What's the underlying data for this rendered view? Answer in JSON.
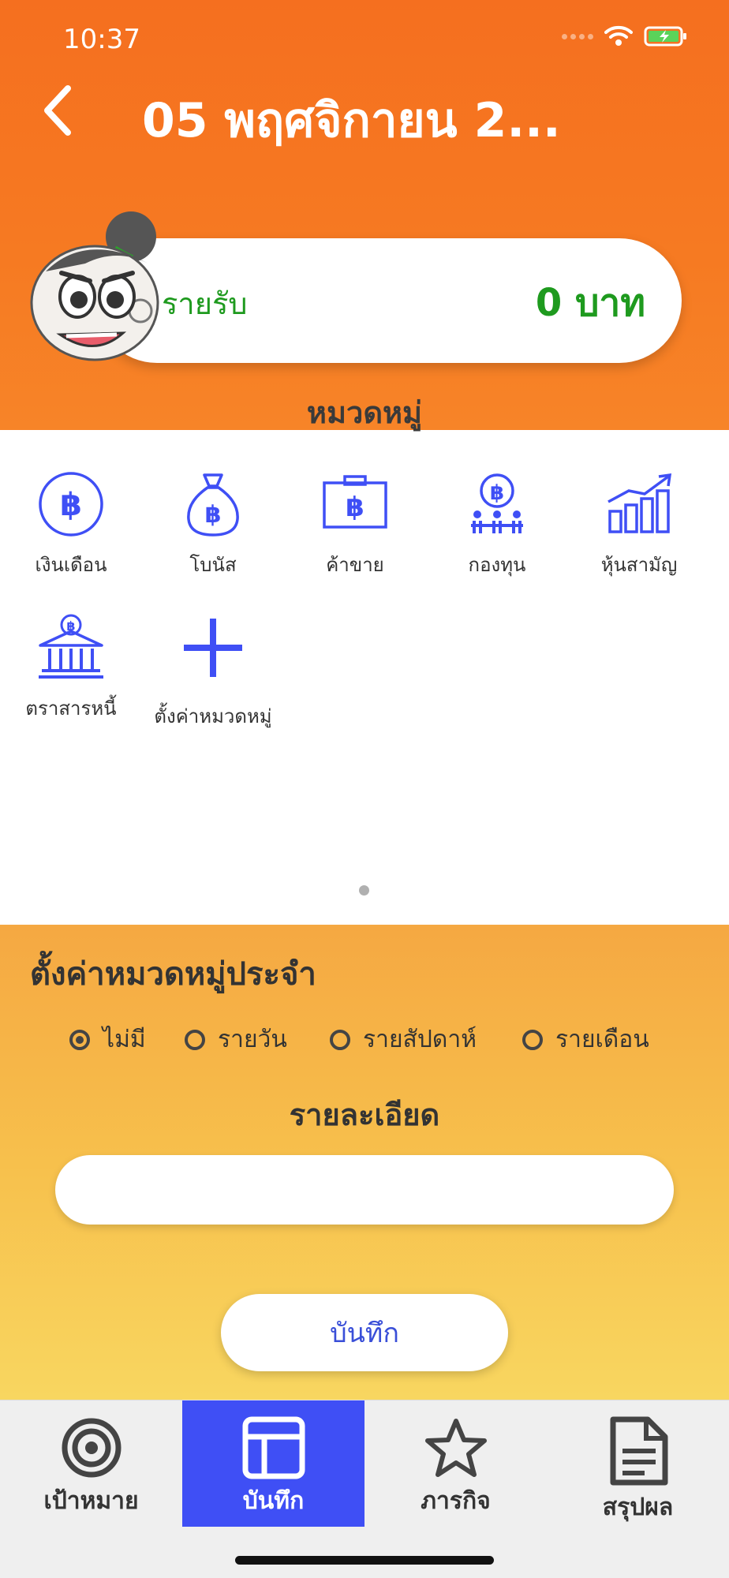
{
  "status_bar": {
    "time": "10:37"
  },
  "header": {
    "title": "05 พฤศจิกายน 2...",
    "back_icon": "chevron-left-icon"
  },
  "income": {
    "label": "รายรับ",
    "value": "0 บาท",
    "color": "#1e9a1e"
  },
  "categories": {
    "heading": "หมวดหมู่",
    "items": [
      {
        "label": "เงินเดือน",
        "icon": "baht-coin-icon"
      },
      {
        "label": "โบนัส",
        "icon": "money-bag-icon"
      },
      {
        "label": "ค้าขาย",
        "icon": "baht-briefcase-icon"
      },
      {
        "label": "กองทุน",
        "icon": "fund-group-icon"
      },
      {
        "label": "หุ้นสามัญ",
        "icon": "stock-chart-icon"
      },
      {
        "label": "ตราสารหนี้",
        "icon": "bank-icon"
      },
      {
        "label": "ตั้งค่าหมวดหมู่",
        "icon": "plus-icon"
      }
    ],
    "accent": "#3f4ff5"
  },
  "recurring": {
    "title": "ตั้งค่าหมวดหมู่ประจำ",
    "options": [
      {
        "label": "ไม่มี",
        "selected": true
      },
      {
        "label": "รายวัน",
        "selected": false
      },
      {
        "label": "รายสัปดาห์",
        "selected": false
      },
      {
        "label": "รายเดือน",
        "selected": false
      }
    ],
    "detail_label": "รายละเอียด",
    "detail_value": "",
    "save_label": "บันทึก"
  },
  "tabbar": {
    "tabs": [
      {
        "label": "เป้าหมาย",
        "icon": "target-icon",
        "active": false
      },
      {
        "label": "บันทึก",
        "icon": "layout-icon",
        "active": true
      },
      {
        "label": "ภารกิจ",
        "icon": "star-icon",
        "active": false
      },
      {
        "label": "สรุปผล",
        "icon": "document-icon",
        "active": false
      }
    ]
  },
  "colors": {
    "header": "#f56f1f",
    "tab_active": "#3f4ff5"
  }
}
